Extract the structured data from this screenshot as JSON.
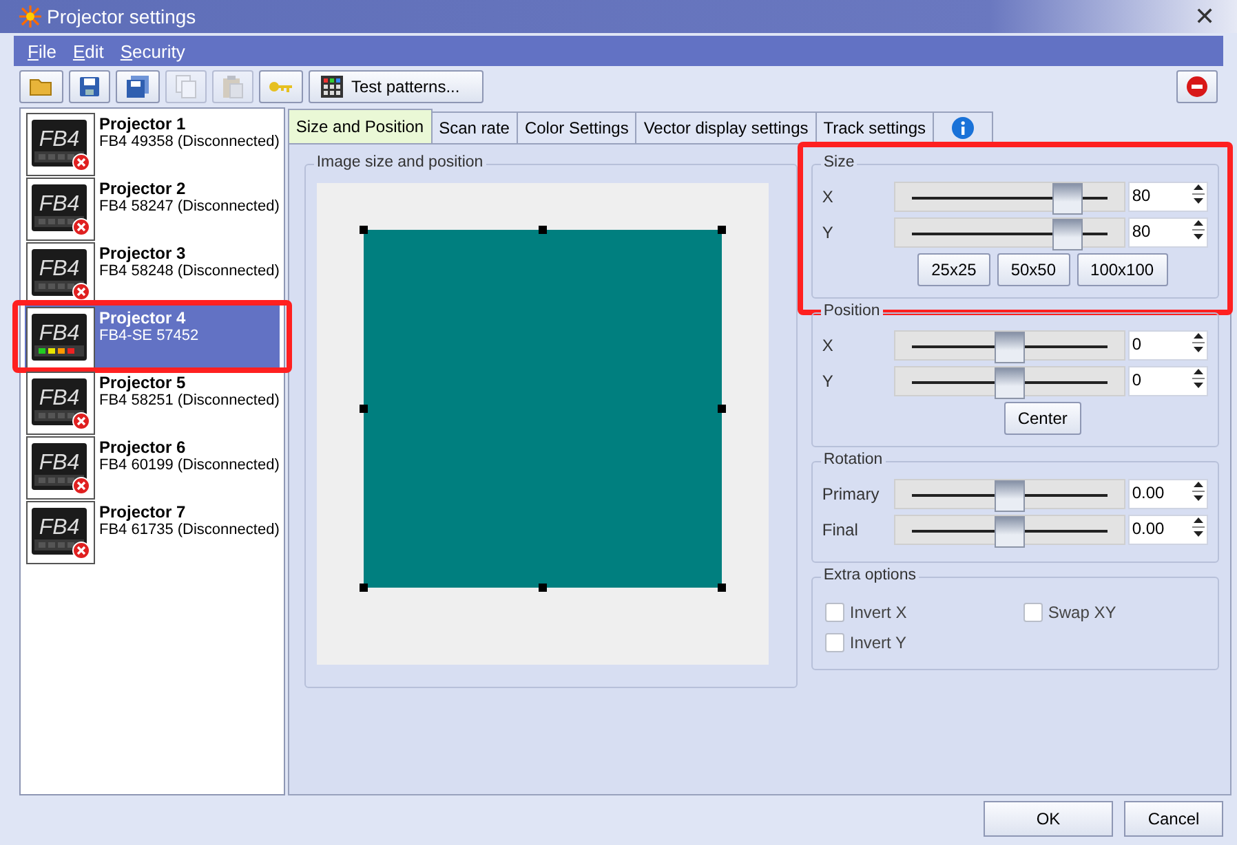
{
  "window": {
    "title": "Projector settings",
    "close_label": "✕"
  },
  "menu": [
    {
      "label": "File"
    },
    {
      "label": "Edit"
    },
    {
      "label": "Security"
    }
  ],
  "toolbar": [
    {
      "kind": "open",
      "disabled": false
    },
    {
      "kind": "save",
      "disabled": false
    },
    {
      "kind": "save-all",
      "disabled": false
    },
    {
      "kind": "copy",
      "disabled": true
    },
    {
      "kind": "paste",
      "disabled": true
    },
    {
      "kind": "key",
      "disabled": false
    },
    {
      "kind": "patterns",
      "label": "Test patterns...",
      "disabled": false
    }
  ],
  "projectors": [
    {
      "name": "Projector 1",
      "detail": "FB4 49358 (Disconnected)",
      "icon_text": "FB4",
      "connected": false,
      "selected": false,
      "highlighted": false
    },
    {
      "name": "Projector 2",
      "detail": "FB4 58247 (Disconnected)",
      "icon_text": "FB4",
      "connected": false,
      "selected": false,
      "highlighted": false
    },
    {
      "name": "Projector 3",
      "detail": "FB4 58248 (Disconnected)",
      "icon_text": "FB4",
      "connected": false,
      "selected": false,
      "highlighted": false
    },
    {
      "name": "Projector 4",
      "detail": "FB4-SE 57452",
      "icon_text": "FB4",
      "connected": true,
      "selected": true,
      "highlighted": true
    },
    {
      "name": "Projector 5",
      "detail": "FB4 58251 (Disconnected)",
      "icon_text": "FB4",
      "connected": false,
      "selected": false,
      "highlighted": false
    },
    {
      "name": "Projector 6",
      "detail": "FB4 60199 (Disconnected)",
      "icon_text": "FB4",
      "connected": false,
      "selected": false,
      "highlighted": false
    },
    {
      "name": "Projector 7",
      "detail": "FB4 61735 (Disconnected)",
      "icon_text": "FB4",
      "connected": false,
      "selected": false,
      "highlighted": false
    }
  ],
  "tabs": [
    {
      "kind": "text",
      "label": "Size and Position",
      "selected": true
    },
    {
      "kind": "text",
      "label": "Scan rate",
      "selected": false
    },
    {
      "kind": "text",
      "label": "Color Settings",
      "selected": false
    },
    {
      "kind": "text",
      "label": "Vector display settings",
      "selected": false
    },
    {
      "kind": "text",
      "label": "Track settings",
      "selected": false
    },
    {
      "kind": "info",
      "selected": false
    }
  ],
  "image_panel": {
    "title": "Image size and position"
  },
  "groups": [
    {
      "title": "Size",
      "highlighted": true,
      "sliders": [
        {
          "label": "X",
          "level": 0.8,
          "value": "80"
        },
        {
          "label": "Y",
          "level": 0.8,
          "value": "80"
        }
      ],
      "buttons": [
        "25x25",
        "50x50",
        "100x100"
      ]
    },
    {
      "title": "Position",
      "highlighted": false,
      "sliders": [
        {
          "label": "X",
          "level": 0.5,
          "value": "0"
        },
        {
          "label": "Y",
          "level": 0.5,
          "value": "0"
        }
      ],
      "buttons": [
        "Center"
      ]
    },
    {
      "title": "Rotation",
      "highlighted": false,
      "sliders": [
        {
          "label": "Primary",
          "level": 0.5,
          "value": "0.00"
        },
        {
          "label": "Final",
          "level": 0.5,
          "value": "0.00"
        }
      ]
    }
  ],
  "extra_options": {
    "title": "Extra options",
    "checkboxes": [
      {
        "label": "Invert X",
        "checked": false
      },
      {
        "label": "Swap XY",
        "checked": false
      },
      {
        "label": "Invert Y",
        "checked": false
      }
    ]
  },
  "footer_buttons": [
    "OK",
    "Cancel"
  ]
}
